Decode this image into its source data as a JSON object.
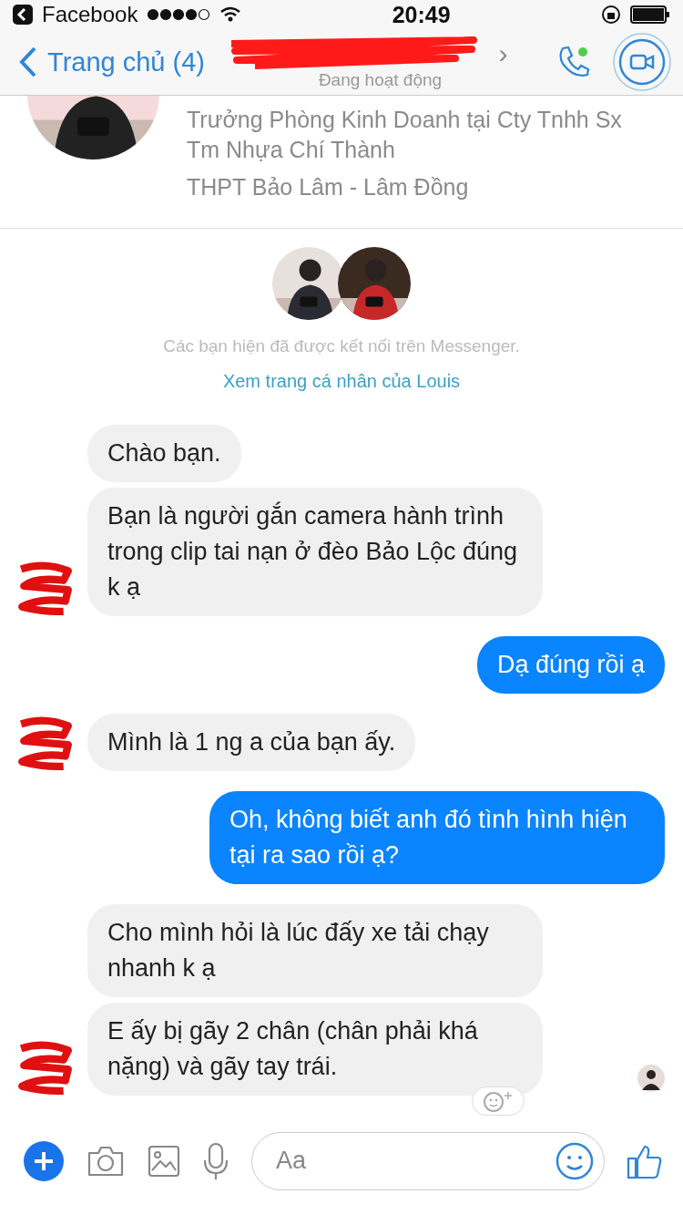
{
  "status_bar": {
    "back_app": "Facebook",
    "time": "20:49"
  },
  "nav": {
    "back_label": "Trang chủ (4)",
    "title_chevron": "›",
    "subtitle": "Đang hoạt động"
  },
  "profile": {
    "lines": [
      "Trưởng Phòng Kinh Doanh tại Cty Tnhh Sx Tm Nhựa Chí Thành",
      "THPT Bảo Lâm - Lâm Đồng"
    ]
  },
  "connected": {
    "note": "Các bạn hiện đã được kết nối trên Messenger.",
    "link": "Xem trang cá nhân của Louis"
  },
  "messages": [
    {
      "kind": "received",
      "text": "Chào bạn.",
      "avatar": false,
      "seen": false
    },
    {
      "kind": "received",
      "text": "Bạn là người gắn camera hành trình trong clip tai nạn ở đèo Bảo Lộc đúng k ạ",
      "avatar": true,
      "seen": false
    },
    {
      "kind": "sent",
      "text": "Dạ đúng rồi ạ",
      "avatar": false,
      "seen": false
    },
    {
      "kind": "received",
      "text": "Mình là 1 ng a  của bạn ấy.",
      "avatar": true,
      "seen": false
    },
    {
      "kind": "sent",
      "text": "Oh, không biết anh đó tình hình hiện tại ra sao rồi ạ?",
      "avatar": false,
      "seen": false
    },
    {
      "kind": "received",
      "text": "Cho mình hỏi là lúc đấy xe tải chạy nhanh k ạ",
      "avatar": false,
      "seen": false
    },
    {
      "kind": "received",
      "text": "E ấy bị gãy 2 chân (chân phải khá nặng) và gãy tay trái.",
      "avatar": true,
      "seen": true
    }
  ],
  "composer": {
    "placeholder": "Aa"
  }
}
